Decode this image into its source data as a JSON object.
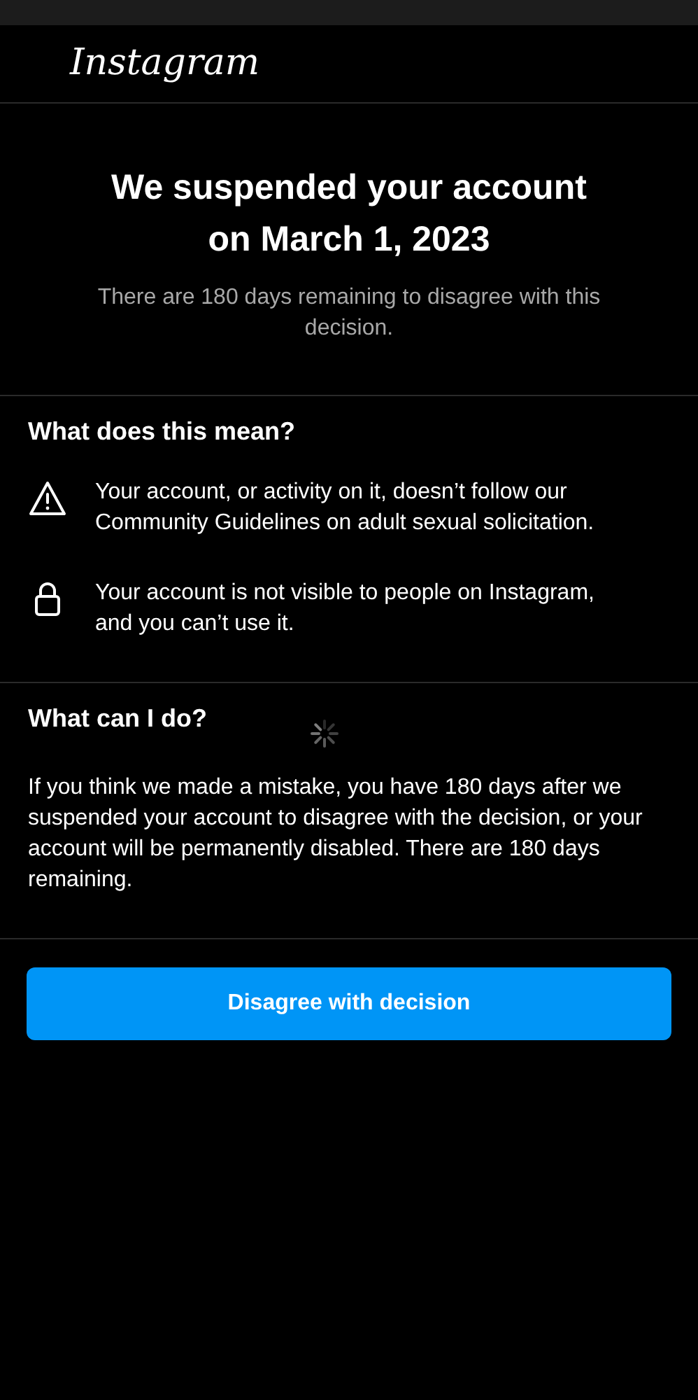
{
  "header": {
    "logo": "Instagram"
  },
  "title": "We suspended your account on March 1, 2023",
  "subtitle": "There are 180 days remaining to disagree with this decision.",
  "sections": [
    {
      "heading": "What does this mean?",
      "items": [
        {
          "kind": "warning",
          "text": "Your account, or activity on it, doesn’t follow our Community Guidelines on adult sexual solicitation."
        },
        {
          "kind": "lock",
          "text": "Your account is not visible to people on Instagram, and you can’t use it."
        }
      ]
    },
    {
      "heading": "What can I do?",
      "loading": true,
      "body": "If you think we made a mistake, you have 180 days after we suspended your account to disagree with the decision, or your account will be permanently disabled. There are 180 days remaining."
    }
  ],
  "button": "Disagree with decision"
}
